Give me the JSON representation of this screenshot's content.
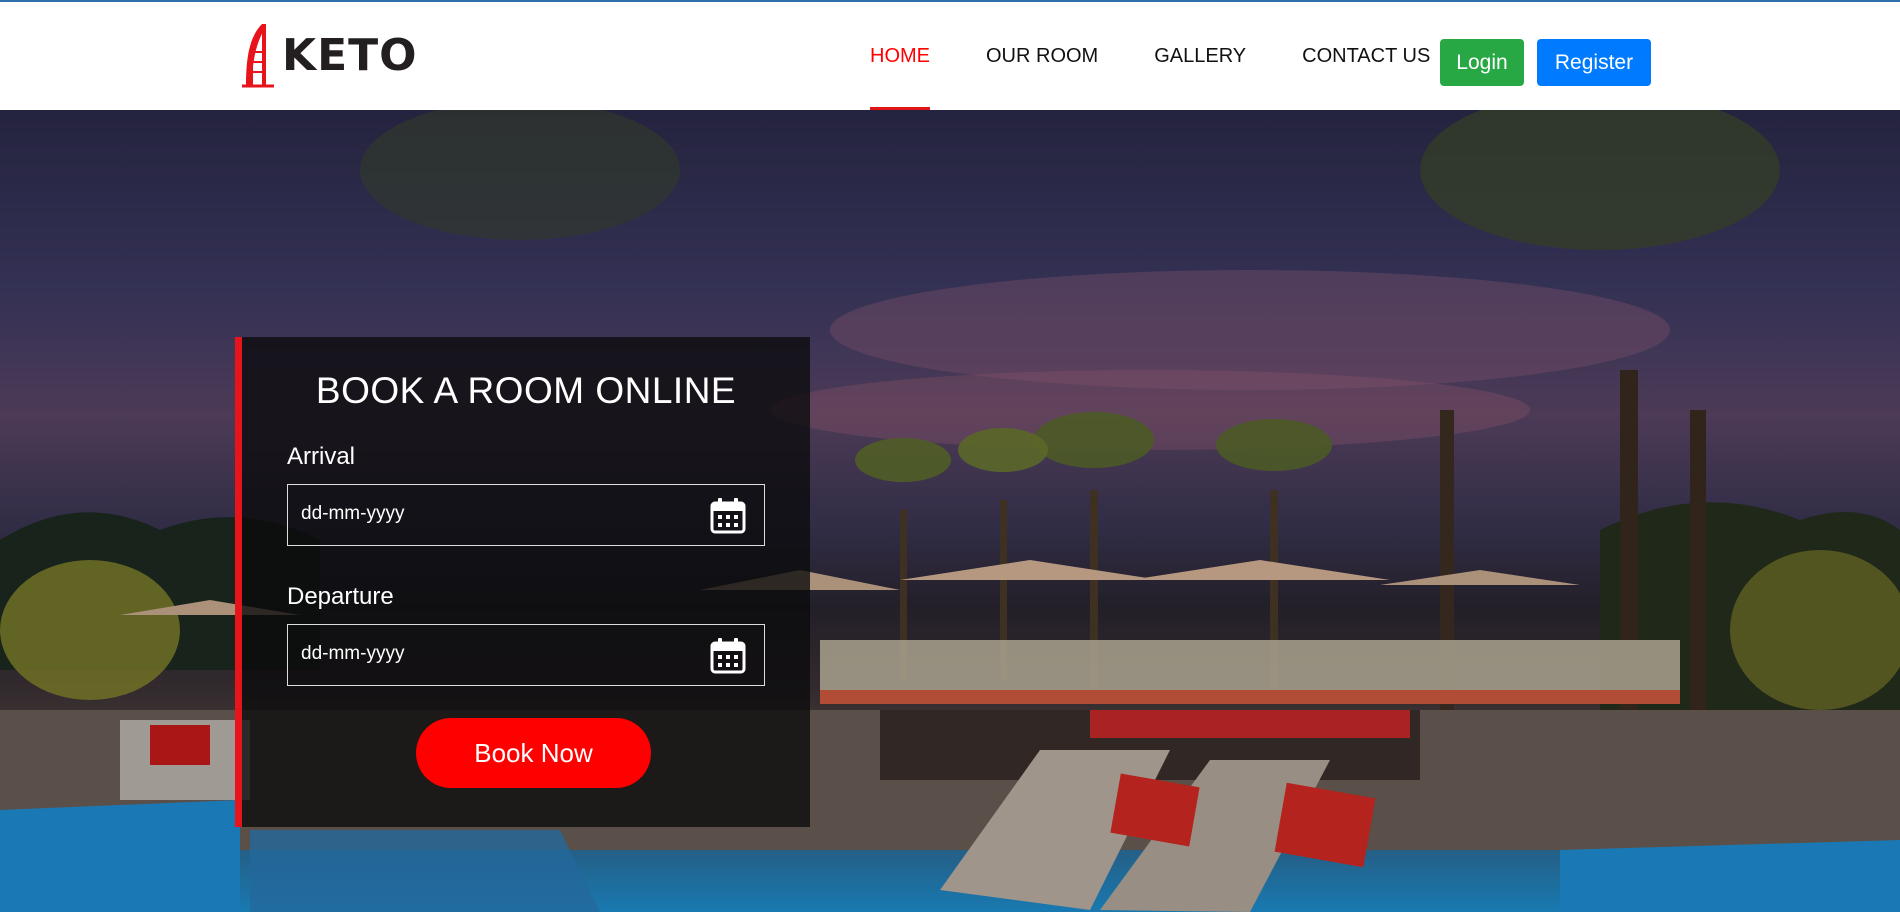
{
  "brand": {
    "name": "KETO",
    "logo_icon": "sail-hotel-icon",
    "accent": "#e8141b"
  },
  "nav": {
    "items": [
      {
        "label": "HOME",
        "active": true
      },
      {
        "label": "OUR ROOM",
        "active": false
      },
      {
        "label": "GALLERY",
        "active": false
      },
      {
        "label": "CONTACT US",
        "active": false
      }
    ],
    "login_label": "Login",
    "register_label": "Register"
  },
  "booking": {
    "title": "BOOK A ROOM ONLINE",
    "arrival_label": "Arrival",
    "arrival_value": "dd-mm-yyyy",
    "departure_label": "Departure",
    "departure_value": "dd-mm-yyyy",
    "calendar_icon": "calendar-icon",
    "submit_label": "Book Now"
  },
  "colors": {
    "login": "#28a745",
    "register": "#007bff",
    "book_now": "#ff0000",
    "nav_active": "#ff0000"
  }
}
